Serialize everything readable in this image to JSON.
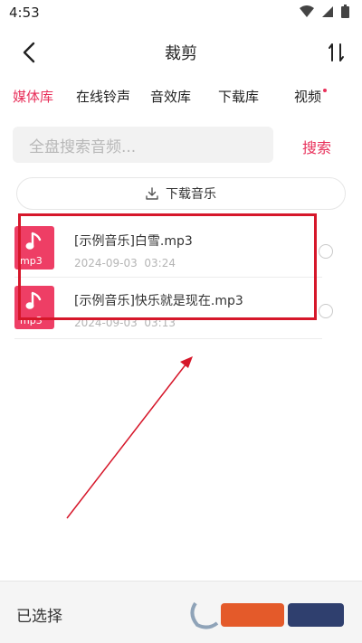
{
  "status_bar": {
    "time": "4:53",
    "icons": [
      "wifi-icon",
      "signal-icon",
      "battery-icon"
    ]
  },
  "header": {
    "title": "裁剪",
    "back_icon": "back-arrow-icon",
    "sort_icon": "sort-icon"
  },
  "tabs": [
    {
      "label": "媒体库",
      "active": true
    },
    {
      "label": "在线铃声",
      "active": false
    },
    {
      "label": "音效库",
      "active": false
    },
    {
      "label": "下载库",
      "active": false
    },
    {
      "label": "视频",
      "active": false,
      "badge_dot": true
    }
  ],
  "search": {
    "placeholder": "全盘搜索音频...",
    "button_label": "搜索"
  },
  "download_button": {
    "label": "下载音乐",
    "icon": "download-icon"
  },
  "files": [
    {
      "name": "[示例音乐]白雪.mp3",
      "date": "2024-09-03",
      "time": "03:24",
      "ext": "mp3"
    },
    {
      "name": "[示例音乐]快乐就是现在.mp3",
      "date": "2024-09-03",
      "time": "03:13",
      "ext": "mp3"
    }
  ],
  "bottom_bar": {
    "selected_label": "已选择"
  },
  "colors": {
    "accent": "#e8315b",
    "file_icon": "#ee3e65",
    "annotation_red": "#d6172a"
  }
}
